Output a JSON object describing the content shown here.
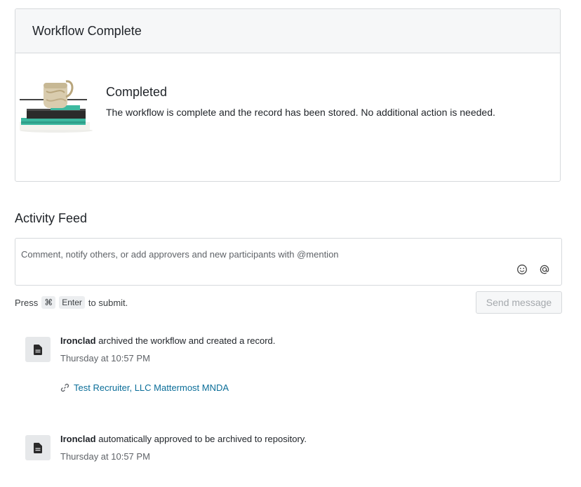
{
  "completion_card": {
    "header": "Workflow Complete",
    "status_title": "Completed",
    "status_message": "The workflow is complete and the record has been stored. No additional action is needed."
  },
  "activity": {
    "title": "Activity Feed",
    "comment_placeholder": "Comment, notify others, or add approvers and new participants with @mention",
    "hint_prefix": "Press",
    "hint_key_1": "⌘",
    "hint_key_2": "Enter",
    "hint_suffix": "to submit.",
    "send_label": "Send message",
    "items": [
      {
        "actor": "Ironclad",
        "action": " archived the workflow and created a record.",
        "time": "Thursday at 10:57 PM",
        "link": "Test Recruiter, LLC Mattermost MNDA"
      },
      {
        "actor": "Ironclad",
        "action": " automatically approved to be archived to repository.",
        "time": "Thursday at 10:57 PM"
      }
    ]
  },
  "icons": {
    "illustration": "stacked-books-jar-illustration",
    "emoji": "smiley-icon",
    "mention": "at-sign-icon",
    "document": "document-icon",
    "link": "link-icon"
  },
  "colors": {
    "link": "#0b6e99",
    "accent_teal": "#3db9a0",
    "disabled_text": "#a5a9ad"
  }
}
